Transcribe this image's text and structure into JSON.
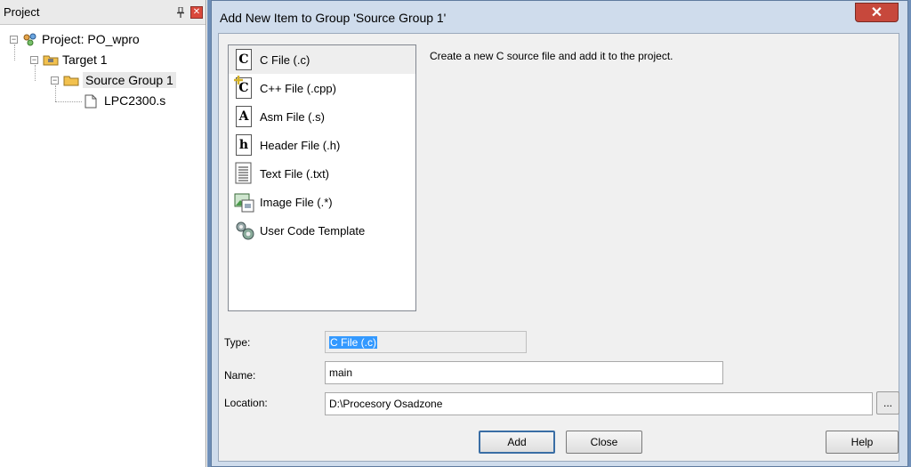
{
  "project_panel": {
    "title": "Project",
    "pin_icon": "pin-icon",
    "close_icon": "close-icon",
    "tree": {
      "project": "Project: PO_wpro",
      "target": "Target 1",
      "group": "Source Group 1",
      "file": "LPC2300.s"
    }
  },
  "dialog": {
    "title": "Add New Item to Group 'Source Group 1'",
    "close_symbol": "✕",
    "description": "Create a new C source file and add it to the project.",
    "file_types": [
      {
        "label": "C File (.c)",
        "icon": "c-file-icon",
        "glyph": "C"
      },
      {
        "label": "C++ File (.cpp)",
        "icon": "cpp-file-icon",
        "glyph": "C"
      },
      {
        "label": "Asm File (.s)",
        "icon": "asm-file-icon",
        "glyph": "A"
      },
      {
        "label": "Header File (.h)",
        "icon": "header-file-icon",
        "glyph": "h"
      },
      {
        "label": "Text File (.txt)",
        "icon": "text-file-icon",
        "glyph": ""
      },
      {
        "label": "Image File (.*)",
        "icon": "image-file-icon",
        "glyph": ""
      },
      {
        "label": "User Code Template",
        "icon": "template-icon",
        "glyph": ""
      }
    ],
    "type_label": "Type:",
    "type_value": "C File (.c)",
    "name_label": "Name:",
    "name_value": "main",
    "location_label": "Location:",
    "location_value": "D:\\Procesory Osadzone",
    "browse_label": "...",
    "buttons": {
      "add": "Add",
      "close": "Close",
      "help": "Help"
    }
  },
  "colors": {
    "dialog_frame": "#cfdcec",
    "background": "#6f8fb8",
    "selection": "#3399ff",
    "close_red": "#c7483c"
  }
}
